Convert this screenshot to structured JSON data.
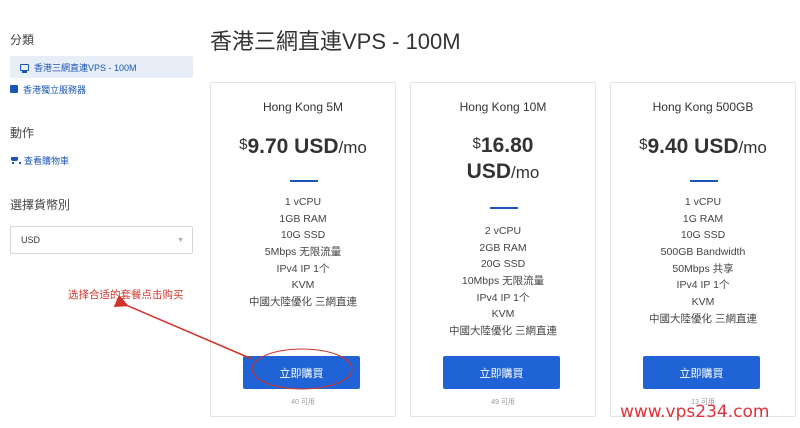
{
  "sidebar": {
    "categories_heading": "分類",
    "categories": [
      {
        "label": "香港三網直連VPS - 100M",
        "icon": "server-icon",
        "active": true
      },
      {
        "label": "香港獨立服務器",
        "icon": "building-icon",
        "active": false
      }
    ],
    "actions_heading": "動作",
    "view_cart_label": "查看購物車",
    "currency_heading": "選擇貨幣別",
    "currency_value": "USD"
  },
  "page": {
    "title": "香港三網直連VPS - 100M"
  },
  "products": [
    {
      "name": "Hong Kong 5M",
      "price_symbol": "$",
      "price_amount": "9.70 USD",
      "price_period": "/mo",
      "features": [
        "1 vCPU",
        "1GB RAM",
        "10G SSD",
        "5Mbps 无限流量",
        "IPv4 IP 1个",
        "KVM",
        "中國大陸優化 三網直連"
      ],
      "button_label": "立即購買",
      "availability": "40 可用"
    },
    {
      "name": "Hong Kong 10M",
      "price_symbol": "$",
      "price_amount": "16.80",
      "price_amount_line2": "USD",
      "price_period": "/mo",
      "features": [
        "2 vCPU",
        "2GB RAM",
        "20G SSD",
        "10Mbps 无限流量",
        "IPv4 IP 1个",
        "KVM",
        "中國大陸優化 三網直連"
      ],
      "button_label": "立即購買",
      "availability": "49 可用"
    },
    {
      "name": "Hong Kong 500GB",
      "price_symbol": "$",
      "price_amount": "9.40 USD",
      "price_period": "/mo",
      "features": [
        "1 vCPU",
        "1G RAM",
        "10G SSD",
        "500GB Bandwidth",
        "50Mbps 共享",
        "IPv4 IP 1个",
        "KVM",
        "中國大陸優化 三網直連"
      ],
      "button_label": "立即購買",
      "availability": "13 可用"
    }
  ],
  "annotation": {
    "text": "选择合适的套餐点击购买",
    "color": "#d0342c"
  },
  "watermark": "www.vps234.com",
  "colors": {
    "accent": "#1f63d6",
    "annotation": "#d0342c",
    "watermark": "#e0303a"
  }
}
